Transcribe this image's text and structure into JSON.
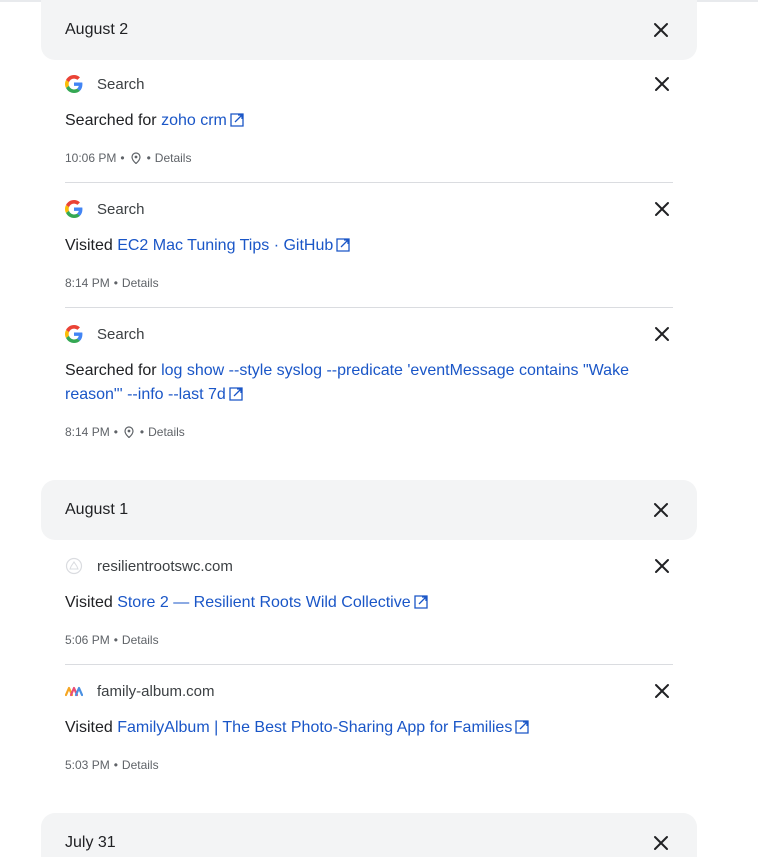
{
  "days": [
    {
      "date": "August 2",
      "entries": [
        {
          "source": "Search",
          "icon": "google-icon",
          "action": "Searched for",
          "link": "zoho crm",
          "time": "10:06 PM",
          "has_location": true,
          "details": "Details"
        },
        {
          "source": "Search",
          "icon": "google-icon",
          "action": "Visited",
          "link": "EC2 Mac Tuning Tips · GitHub",
          "time": "8:14 PM",
          "has_location": false,
          "details": "Details"
        },
        {
          "source": "Search",
          "icon": "google-icon",
          "action": "Searched for",
          "link": "log show --style syslog --predicate 'eventMessage contains \"Wake reason\"' --info --last 7d",
          "time": "8:14 PM",
          "has_location": true,
          "details": "Details"
        }
      ]
    },
    {
      "date": "August 1",
      "entries": [
        {
          "source": "resilientrootswc.com",
          "icon": "site-globe-icon",
          "action": "Visited",
          "link": "Store 2 — Resilient Roots Wild Collective",
          "time": "5:06 PM",
          "has_location": false,
          "details": "Details"
        },
        {
          "source": "family-album.com",
          "icon": "family-album-logo-icon",
          "action": "Visited",
          "link": "FamilyAlbum | The Best Photo-Sharing App for Families",
          "time": "5:03 PM",
          "has_location": false,
          "details": "Details"
        }
      ]
    },
    {
      "date": "July 31",
      "entries": []
    }
  ],
  "colors": {
    "link": "#1a56c7",
    "header_bg": "#f3f4f5",
    "meta_text": "#5f6368"
  }
}
